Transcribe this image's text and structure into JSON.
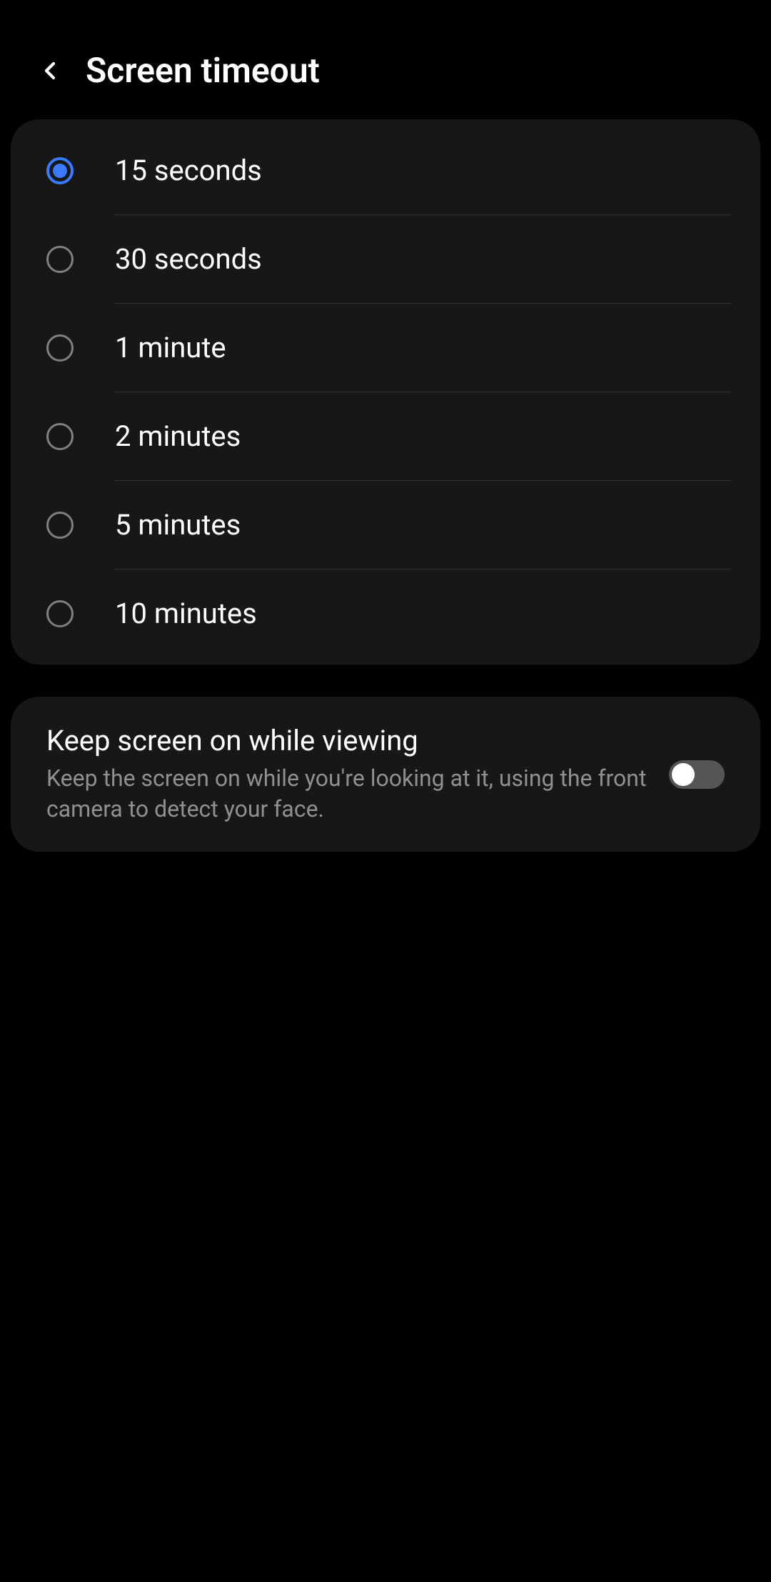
{
  "header": {
    "title": "Screen timeout"
  },
  "timeout_options": [
    {
      "label": "15 seconds",
      "selected": true
    },
    {
      "label": "30 seconds",
      "selected": false
    },
    {
      "label": "1 minute",
      "selected": false
    },
    {
      "label": "2 minutes",
      "selected": false
    },
    {
      "label": "5 minutes",
      "selected": false
    },
    {
      "label": "10 minutes",
      "selected": false
    }
  ],
  "keep_on": {
    "title": "Keep screen on while viewing",
    "description": "Keep the screen on while you're looking at it, using the front camera to detect your face.",
    "enabled": false
  }
}
